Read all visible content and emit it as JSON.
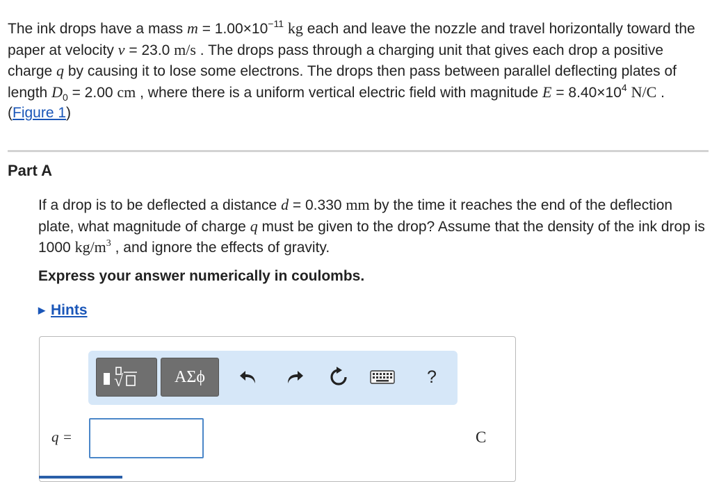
{
  "problem": {
    "t1": "The ink drops have a mass ",
    "m_var": "m",
    "t2": " = 1.00×10",
    "m_exp": "−11",
    "t3": " ",
    "m_unit": "kg",
    "t4": " each and leave the nozzle and travel horizontally toward the paper at velocity ",
    "v_var": "v",
    "t5": " = 23.0 ",
    "v_unit": "m/s",
    "t6": " . The drops pass through a charging unit that gives each drop a positive charge ",
    "q_var": "q",
    "t7": " by causing it to lose some electrons. The drops then pass between parallel deflecting plates of length ",
    "D_var": "D",
    "D_sub": "0",
    "t8": " = 2.00 ",
    "D_unit": "cm",
    "t9": " , where there is a uniform vertical electric field with magnitude ",
    "E_var": "E",
    "t10": " = 8.40×10",
    "E_exp": "4",
    "t11": " ",
    "E_unit": "N/C",
    "t12": " . (",
    "figure_link": "Figure 1",
    "t13": ")"
  },
  "part": {
    "title": "Part A"
  },
  "question": {
    "t1": "If a drop is to be deflected a distance ",
    "d_var": "d",
    "t2": " = 0.330 ",
    "d_unit": "mm",
    "t3": " by the time it reaches the end of the deflection plate, what magnitude of charge ",
    "q_var": "q",
    "t4": " must be given to the drop? Assume that the density of the ink drop is 1000 ",
    "rho_unit": "kg/m",
    "rho_exp": "3",
    "t5": " , and ignore the effects of gravity."
  },
  "instruction": "Express your answer numerically in coulombs.",
  "hints_label": "Hints",
  "toolbar": {
    "templates_icon": "templates-icon",
    "symbols_label": "ΑΣϕ",
    "undo_icon": "undo-icon",
    "redo_icon": "redo-icon",
    "reset_icon": "reset-icon",
    "keyboard_icon": "keyboard-icon",
    "help_label": "?"
  },
  "answer": {
    "label": "q =",
    "value": "",
    "unit": "C"
  },
  "colors": {
    "link": "#1a56b8",
    "toolbar_bg": "#d6e7f8",
    "input_border": "#4a86c8"
  }
}
